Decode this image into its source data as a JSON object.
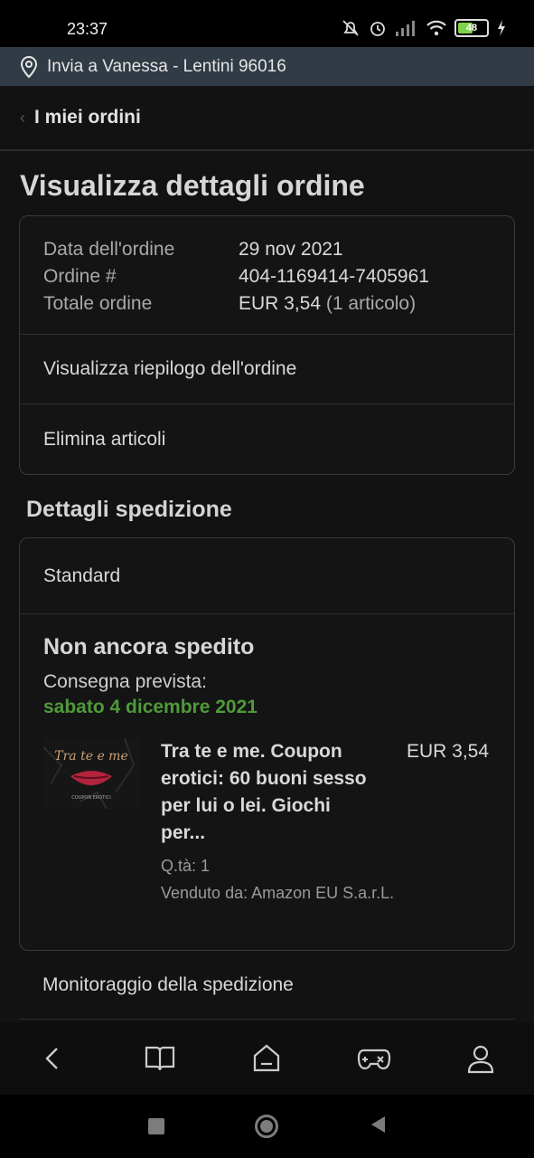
{
  "status_bar": {
    "time": "23:37",
    "battery": "48"
  },
  "deliver_to": {
    "text": "Invia a Vanessa - Lentini 96016"
  },
  "back": {
    "label": "I miei ordini"
  },
  "page_title": "Visualizza dettagli ordine",
  "order_summary": {
    "date_label": "Data dell'ordine",
    "date_value": "29 nov 2021",
    "number_label": "Ordine #",
    "number_value": "404-1169414-7405961",
    "total_label": "Totale ordine",
    "total_value": "EUR 3,54",
    "total_items": "(1 articolo)"
  },
  "actions": {
    "view_summary": "Visualizza riepilogo dell'ordine",
    "delete_items": "Elimina articoli"
  },
  "shipping": {
    "section_title": "Dettagli spedizione",
    "method": "Standard",
    "status": "Non ancora spedito",
    "expected_label": "Consegna prevista:",
    "expected_date": "sabato 4 dicembre 2021",
    "status_color": "#4f9a3a",
    "item": {
      "title": "Tra te e me. Coupon erotici: 60 buoni sesso per lui o lei. Giochi per...",
      "quantity": "Q.tà: 1",
      "seller": "Venduto da: Amazon EU S.a.r.L.",
      "price": "EUR 3,54",
      "thumb_text": "Tra te e me",
      "thumb_subtext": "COUPON EROTICI"
    },
    "tracking_label": "Monitoraggio della spedizione"
  },
  "bottom_nav": [
    "back-icon",
    "book-icon",
    "home-icon",
    "gamepad-icon",
    "profile-icon"
  ],
  "system_nav": [
    "recents-icon",
    "home-circle-icon",
    "back-triangle-icon"
  ]
}
